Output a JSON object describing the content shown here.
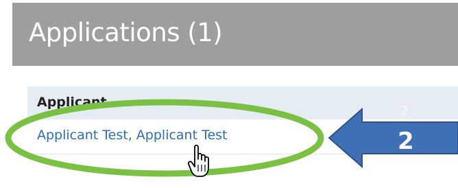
{
  "header": {
    "title": "Applications (1)"
  },
  "table": {
    "column_header": "Applicant",
    "rows": [
      {
        "applicant": "Applicant Test, Applicant Test"
      }
    ]
  },
  "annotations": {
    "arrow_label": "2",
    "faint_label": "2",
    "ellipse_color": "#7ac143",
    "arrow_color": "#3f6fb4"
  },
  "icons": {
    "cursor": "hand-pointer-icon"
  }
}
